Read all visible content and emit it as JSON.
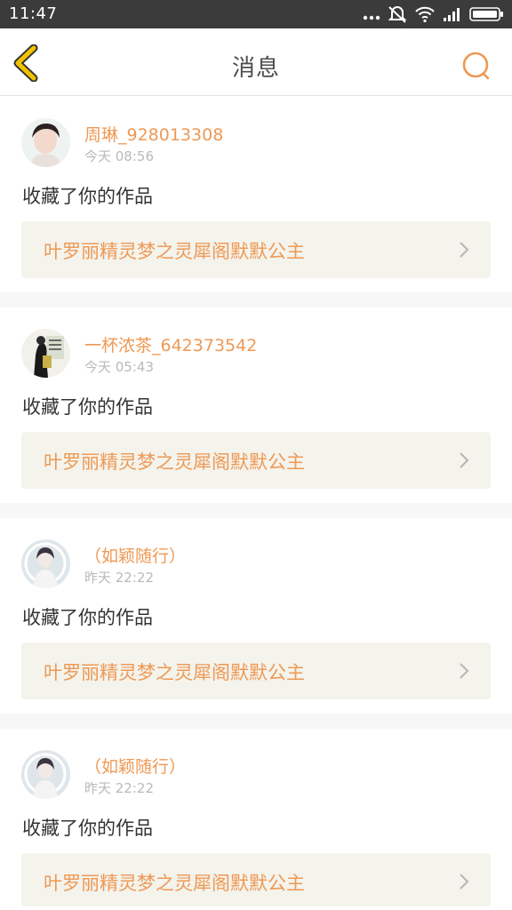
{
  "status_bar": {
    "time": "11:47",
    "icons": [
      "more-dots-icon",
      "alarm-off-icon",
      "wifi-icon",
      "signal-icon",
      "battery-icon"
    ]
  },
  "header": {
    "title": "消息",
    "back_icon": "chevron-left-icon",
    "search_icon": "search-icon"
  },
  "colors": {
    "accent": "#ee9955",
    "back_arrow": "#f2c200",
    "card_bg": "#f4f3ec",
    "separator": "#f7f7f7",
    "status_bar": "#3b3b3b"
  },
  "messages": [
    {
      "username": "周琳_928013308",
      "time": "今天 08:56",
      "action": "收藏了你的作品",
      "work_title": "叶罗丽精灵梦之灵犀阁默默公主"
    },
    {
      "username": "一杯浓茶_642373542",
      "time": "今天 05:43",
      "action": "收藏了你的作品",
      "work_title": "叶罗丽精灵梦之灵犀阁默默公主"
    },
    {
      "username": "（如颖随行）",
      "time": "昨天 22:22",
      "action": "收藏了你的作品",
      "work_title": "叶罗丽精灵梦之灵犀阁默默公主"
    },
    {
      "username": "（如颖随行）",
      "time": "昨天 22:22",
      "action": "收藏了你的作品",
      "work_title": "叶罗丽精灵梦之灵犀阁默默公主"
    }
  ]
}
